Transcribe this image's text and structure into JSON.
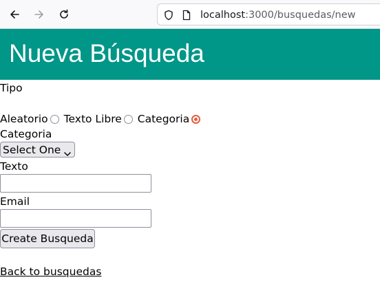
{
  "browser": {
    "url_host": "localhost",
    "url_path": ":3000/busquedas/new"
  },
  "header": {
    "title": "Nueva Búsqueda"
  },
  "form": {
    "tipo_label": "Tipo",
    "radios": [
      {
        "label": "Aleatorio",
        "checked": false
      },
      {
        "label": "Texto Libre",
        "checked": false
      },
      {
        "label": "Categoria",
        "checked": true
      }
    ],
    "categoria_label": "Categoria",
    "categoria_select": {
      "selected": "Select One"
    },
    "texto_label": "Texto",
    "texto_value": "",
    "email_label": "Email",
    "email_value": "",
    "submit_label": "Create Busqueda"
  },
  "back_link": "Back to busquedas",
  "colors": {
    "header_bg": "#009688",
    "radio_checked": "#e05e3e"
  }
}
